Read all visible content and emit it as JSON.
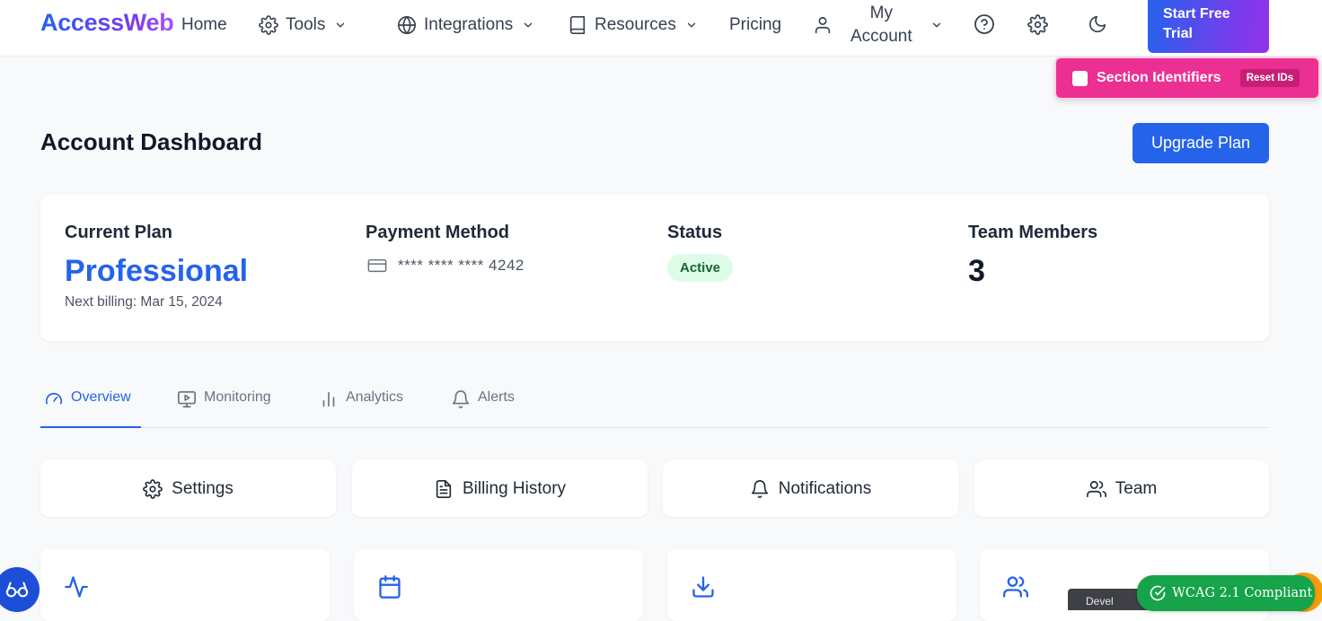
{
  "brand": {
    "name": "AccessWeb"
  },
  "nav": {
    "home": "Home",
    "tools": "Tools",
    "integrations": "Integrations",
    "resources": "Resources",
    "pricing": "Pricing",
    "account_line1": "My",
    "account_line2": "Account",
    "trial_line1": "Start Free",
    "trial_line2": "Trial"
  },
  "section_ids": {
    "label": "Section Identifiers",
    "reset": "Reset IDs",
    "checked": false
  },
  "page": {
    "title": "Account Dashboard",
    "upgrade": "Upgrade Plan"
  },
  "summary": {
    "plan_label": "Current Plan",
    "plan_name": "Professional",
    "next_billing": "Next billing: Mar 15, 2024",
    "payment_label": "Payment Method",
    "card_number": "**** **** **** 4242",
    "status_label": "Status",
    "status_value": "Active",
    "team_label": "Team Members",
    "team_count": "3"
  },
  "tabs": [
    {
      "label": "Overview",
      "icon": "gauge-icon",
      "active": true
    },
    {
      "label": "Monitoring",
      "icon": "monitor-play-icon",
      "active": false
    },
    {
      "label": "Analytics",
      "icon": "bar-chart-icon",
      "active": false
    },
    {
      "label": "Alerts",
      "icon": "bell-icon",
      "active": false
    }
  ],
  "quick_actions": [
    {
      "label": "Settings",
      "icon": "gear-icon"
    },
    {
      "label": "Billing History",
      "icon": "file-text-icon"
    },
    {
      "label": "Notifications",
      "icon": "bell-icon"
    },
    {
      "label": "Team",
      "icon": "users-icon"
    }
  ],
  "stat_cards": [
    {
      "icon": "activity-icon"
    },
    {
      "icon": "calendar-icon"
    },
    {
      "icon": "download-icon"
    },
    {
      "icon": "users-icon"
    }
  ],
  "widgets": {
    "dev_chip": "Devel",
    "wcag": "WCAG 2.1 Compliant"
  },
  "colors": {
    "accent": "#2563eb",
    "brand_gradient_end": "#a855f7",
    "section_ids_bg": "#ec2f92",
    "status_active_bg": "#dcfce7",
    "status_active_text": "#166534",
    "wcag_bg": "#16a34a"
  }
}
